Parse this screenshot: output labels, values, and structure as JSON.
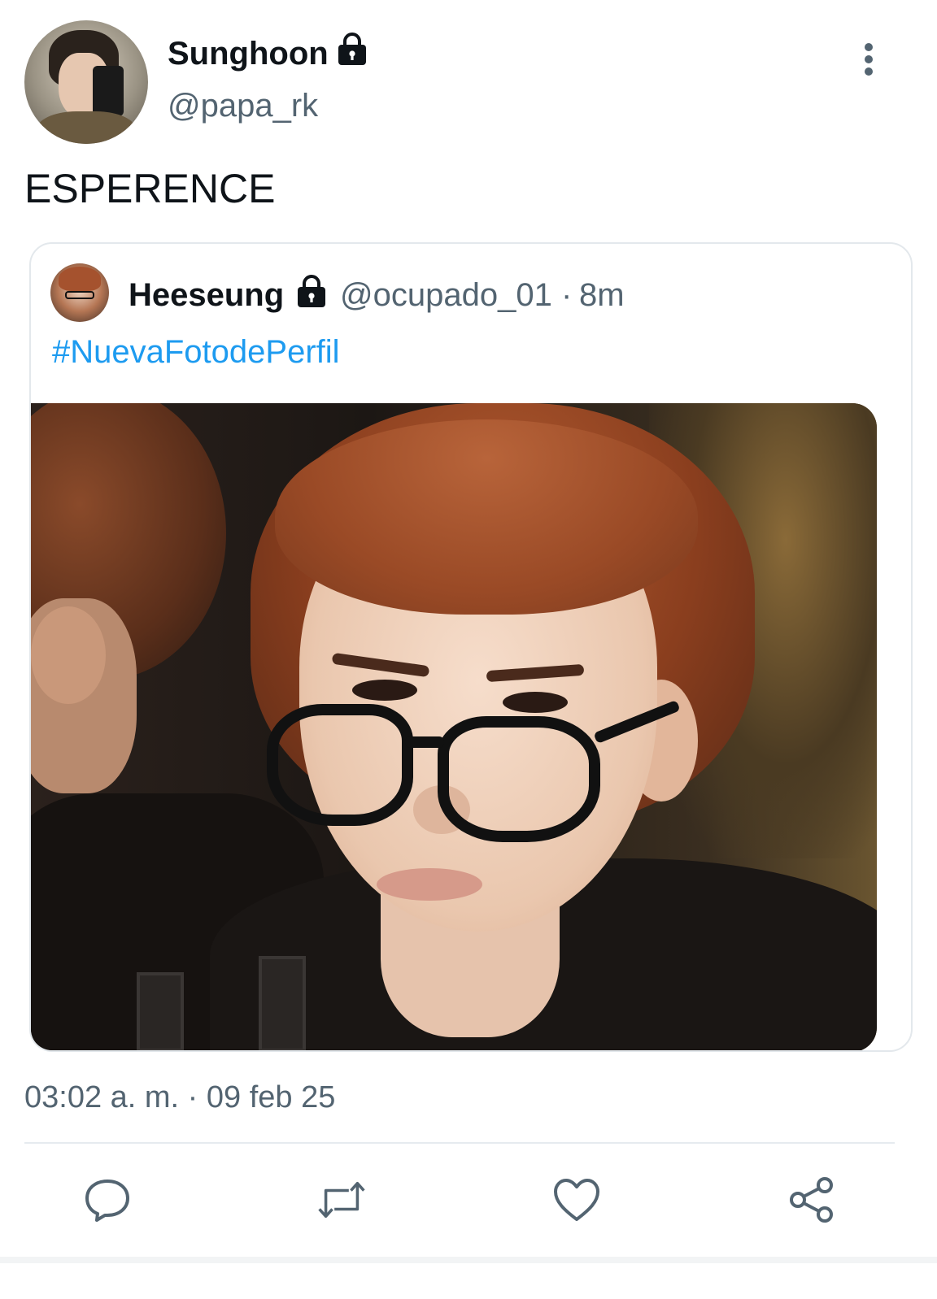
{
  "tweet": {
    "author": {
      "display_name": "Sunghoon",
      "handle": "@papa_rk",
      "protected_icon": "lock-icon"
    },
    "text": "ESPERENCE",
    "more_icon": "more-vertical-icon",
    "timestamp": "03:02 a. m. · 09 feb 25"
  },
  "quoted": {
    "display_name": "Heeseung",
    "protected_icon": "lock-icon",
    "handle": "@ocupado_01",
    "separator": "·",
    "time": "8m",
    "hashtag": "#NuevaFotodePerfil"
  },
  "actions": [
    {
      "icon": "reply-icon"
    },
    {
      "icon": "retweet-icon"
    },
    {
      "icon": "like-icon"
    },
    {
      "icon": "share-icon"
    }
  ],
  "colors": {
    "text": "#0f1419",
    "secondary": "#536471",
    "link": "#1d9bf0",
    "border": "#e3e8ec"
  }
}
